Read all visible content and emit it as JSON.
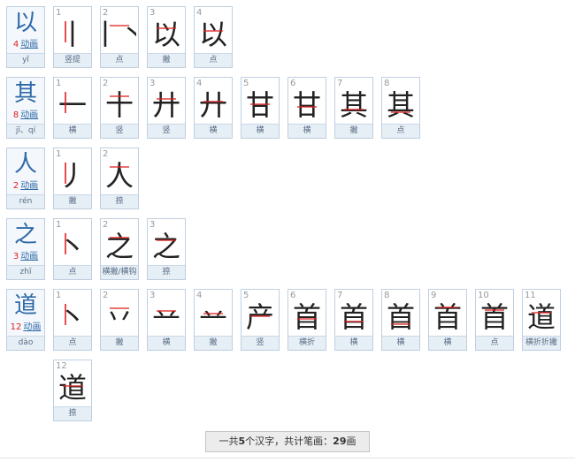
{
  "colors": {
    "accent": "#2f6aa8",
    "stroke_highlight": "#e02020",
    "label_bg": "#e6eef6"
  },
  "anim_label": "动画",
  "summary": {
    "prefix": "一共",
    "char_count": "5",
    "middle": "个汉字，共计笔画：",
    "stroke_total": "29",
    "suffix": "画"
  },
  "characters": [
    {
      "char": "以",
      "strokes": "4",
      "pinyin": "yǐ",
      "steps": [
        {
          "n": "1",
          "name": "竖提"
        },
        {
          "n": "2",
          "name": "点"
        },
        {
          "n": "3",
          "name": "撇"
        },
        {
          "n": "4",
          "name": "点"
        }
      ]
    },
    {
      "char": "其",
      "strokes": "8",
      "pinyin": "jī、qí",
      "steps": [
        {
          "n": "1",
          "name": "横"
        },
        {
          "n": "2",
          "name": "竖"
        },
        {
          "n": "3",
          "name": "竖"
        },
        {
          "n": "4",
          "name": "横"
        },
        {
          "n": "5",
          "name": "横"
        },
        {
          "n": "6",
          "name": "横"
        },
        {
          "n": "7",
          "name": "撇"
        },
        {
          "n": "8",
          "name": "点"
        }
      ]
    },
    {
      "char": "人",
      "strokes": "2",
      "pinyin": "rén",
      "steps": [
        {
          "n": "1",
          "name": "撇"
        },
        {
          "n": "2",
          "name": "捺"
        }
      ]
    },
    {
      "char": "之",
      "strokes": "3",
      "pinyin": "zhī",
      "steps": [
        {
          "n": "1",
          "name": "点"
        },
        {
          "n": "2",
          "name": "横撇/横钩"
        },
        {
          "n": "3",
          "name": "捺"
        }
      ]
    },
    {
      "char": "道",
      "strokes": "12",
      "pinyin": "dào",
      "steps": [
        {
          "n": "1",
          "name": "点"
        },
        {
          "n": "2",
          "name": "撇"
        },
        {
          "n": "3",
          "name": "横"
        },
        {
          "n": "4",
          "name": "撇"
        },
        {
          "n": "5",
          "name": "竖"
        },
        {
          "n": "6",
          "name": "横折"
        },
        {
          "n": "7",
          "name": "横"
        },
        {
          "n": "8",
          "name": "横"
        },
        {
          "n": "9",
          "name": "横"
        },
        {
          "n": "10",
          "name": "点"
        },
        {
          "n": "11",
          "name": "横折折撇"
        },
        {
          "n": "12",
          "name": "捺"
        }
      ]
    }
  ]
}
